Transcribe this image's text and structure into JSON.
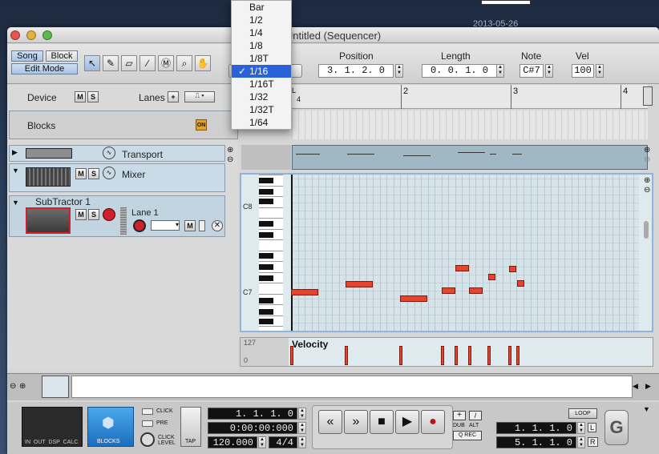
{
  "desktop": {
    "date": "2013-05-26"
  },
  "window": {
    "title": "Untitled (Sequencer)"
  },
  "toolbar": {
    "song_label": "Song",
    "block_label": "Block",
    "edit_mode_label": "Edit Mode",
    "position_label": "Position",
    "position_value": "3.  1.  2.    0",
    "length_label": "Length",
    "length_value": "0.  0.  1.    0",
    "note_label": "Note",
    "note_value": "C#7",
    "vel_label": "Vel",
    "vel_value": "100"
  },
  "snap_menu": {
    "items": [
      "Bar",
      "1/2",
      "1/4",
      "1/8",
      "1/8T",
      "1/16",
      "1/16T",
      "1/32",
      "1/32T",
      "1/64"
    ],
    "selected": "1/16"
  },
  "track_header": {
    "device_label": "Device",
    "lanes_label": "Lanes",
    "m": "M",
    "s": "S"
  },
  "tracks": {
    "blocks": {
      "name": "Blocks",
      "on_label": "ON"
    },
    "transport": {
      "name": "Transport"
    },
    "mixer": {
      "name": "Mixer"
    },
    "subtractor": {
      "name": "SubTractor 1",
      "lane_name": "Lane 1"
    }
  },
  "ruler": {
    "bar1_sub": "4",
    "bar2": "2",
    "bar3": "3",
    "bar4": "4"
  },
  "keyboard": {
    "c8": "C8",
    "c7": "C7"
  },
  "velocity": {
    "label": "Velocity",
    "max": "127",
    "min": "0"
  },
  "bottom": {
    "blocks_label": "BLOCKS",
    "meter_labels": "IN  OUT  DSP  CALC",
    "click_label": "CLICK",
    "pre_label": "PRE",
    "click_level_label": "CLICK\nLEVEL",
    "tap_label": "TAP",
    "position_lcd": "1.  1.  1.    0",
    "time_lcd": "0:00:00:000",
    "tempo_lcd": "120.000",
    "signature_lcd": "4/4",
    "dub_label": "DUB",
    "alt_label": "ALT",
    "qrec_label": "Q REC",
    "loop_label": "LOOP",
    "left_locator": "1.  1.  1.    0",
    "right_locator": "5.  1.  1.    0",
    "l_label": "L",
    "r_label": "R"
  },
  "colors": {
    "note": "#e8432f",
    "selected_menu": "#2a63d8",
    "lane_bg": "#9fb8c4"
  }
}
